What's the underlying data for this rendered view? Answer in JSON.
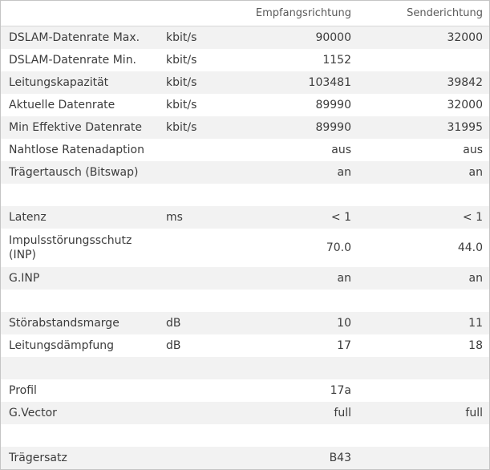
{
  "header": {
    "col_rx": "Empfangsrichtung",
    "col_tx": "Senderichtung"
  },
  "rows": [
    {
      "label": "DSLAM-Datenrate Max.",
      "unit": "kbit/s",
      "rx": "90000",
      "tx": "32000"
    },
    {
      "label": "DSLAM-Datenrate Min.",
      "unit": "kbit/s",
      "rx": "1152",
      "tx": ""
    },
    {
      "label": "Leitungskapazität",
      "unit": "kbit/s",
      "rx": "103481",
      "tx": "39842"
    },
    {
      "label": "Aktuelle Datenrate",
      "unit": "kbit/s",
      "rx": "89990",
      "tx": "32000"
    },
    {
      "label": "Min Effektive Datenrate",
      "unit": "kbit/s",
      "rx": "89990",
      "tx": "31995"
    },
    {
      "label": "Nahtlose Ratenadaption",
      "unit": "",
      "rx": "aus",
      "tx": "aus"
    },
    {
      "label": "Trägertausch (Bitswap)",
      "unit": "",
      "rx": "an",
      "tx": "an"
    },
    {
      "label": "",
      "unit": "",
      "rx": "",
      "tx": ""
    },
    {
      "label": "Latenz",
      "unit": "ms",
      "rx": "< 1",
      "tx": "< 1"
    },
    {
      "label": "Impulsstörungsschutz (INP)",
      "unit": "",
      "rx": "70.0",
      "tx": "44.0"
    },
    {
      "label": "G.INP",
      "unit": "",
      "rx": "an",
      "tx": "an"
    },
    {
      "label": "",
      "unit": "",
      "rx": "",
      "tx": ""
    },
    {
      "label": "Störabstandsmarge",
      "unit": "dB",
      "rx": "10",
      "tx": "11"
    },
    {
      "label": "Leitungsdämpfung",
      "unit": "dB",
      "rx": "17",
      "tx": "18"
    },
    {
      "label": "",
      "unit": "",
      "rx": "",
      "tx": ""
    },
    {
      "label": "Profil",
      "unit": "",
      "rx": "17a",
      "tx": ""
    },
    {
      "label": "G.Vector",
      "unit": "",
      "rx": "full",
      "tx": "full"
    },
    {
      "label": "",
      "unit": "",
      "rx": "",
      "tx": ""
    },
    {
      "label": "Trägersatz",
      "unit": "",
      "rx": "B43",
      "tx": ""
    }
  ]
}
